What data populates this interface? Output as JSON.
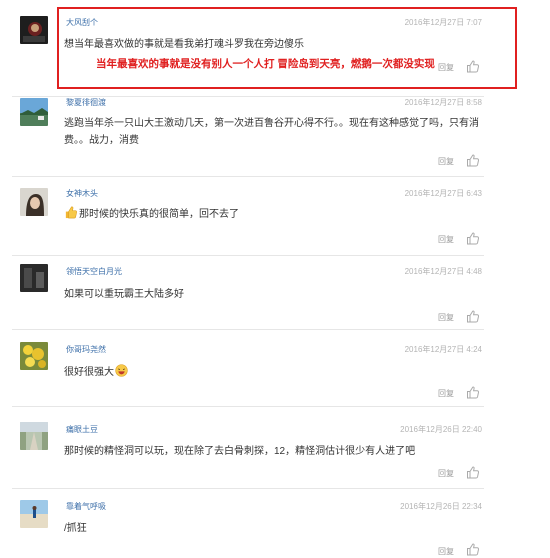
{
  "reply_label": "回复",
  "annotation": {
    "text": "当年最喜欢的事就是没有别人一个人打 冒险岛到天亮，燃鹅一次都没实现"
  },
  "comments": [
    {
      "username": "大风刮个",
      "time": "2016年12月27日 7:07",
      "text": "想当年最喜欢做的事就是看我弟打魂斗罗我在旁边傻乐",
      "avatar_icon": "dark-figure-avatar"
    },
    {
      "username": "黎夏徘徊渡",
      "time": "2016年12月27日 8:58",
      "text": "逃跑当年杀一只山大王激动几天，第一次进百鲁谷开心得不行。。现在有这种感觉了吗，只有消费。。战力，消费",
      "avatar_icon": "landscape-avatar"
    },
    {
      "username": "女神木头",
      "time": "2016年12月27日 6:43",
      "text": "那时候的快乐真的很简单，回不去了",
      "emoji": "thumbs-up-emoji",
      "avatar_icon": "portrait-avatar"
    },
    {
      "username": "领悟天空白月光",
      "time": "2016年12月27日 4:48",
      "text": "如果可以重玩霸王大陆多好",
      "avatar_icon": "dark-room-avatar"
    },
    {
      "username": "你哥玛尧然",
      "time": "2016年12月27日 4:24",
      "text": "很好很强大",
      "emoji_after": "laughing-emoji",
      "avatar_icon": "yellow-flowers-avatar"
    },
    {
      "username": "痛眼土豆",
      "time": "2016年12月26日 22:40",
      "text": "那时候的精怪洞可以玩，现在除了去白骨刺探，12，精怪洞估计很少有人进了吧",
      "avatar_icon": "path-avatar"
    },
    {
      "username": "靠着气呼吸",
      "time": "2016年12月26日 22:34",
      "text": "/抓狂",
      "avatar_icon": "beach-avatar"
    }
  ]
}
